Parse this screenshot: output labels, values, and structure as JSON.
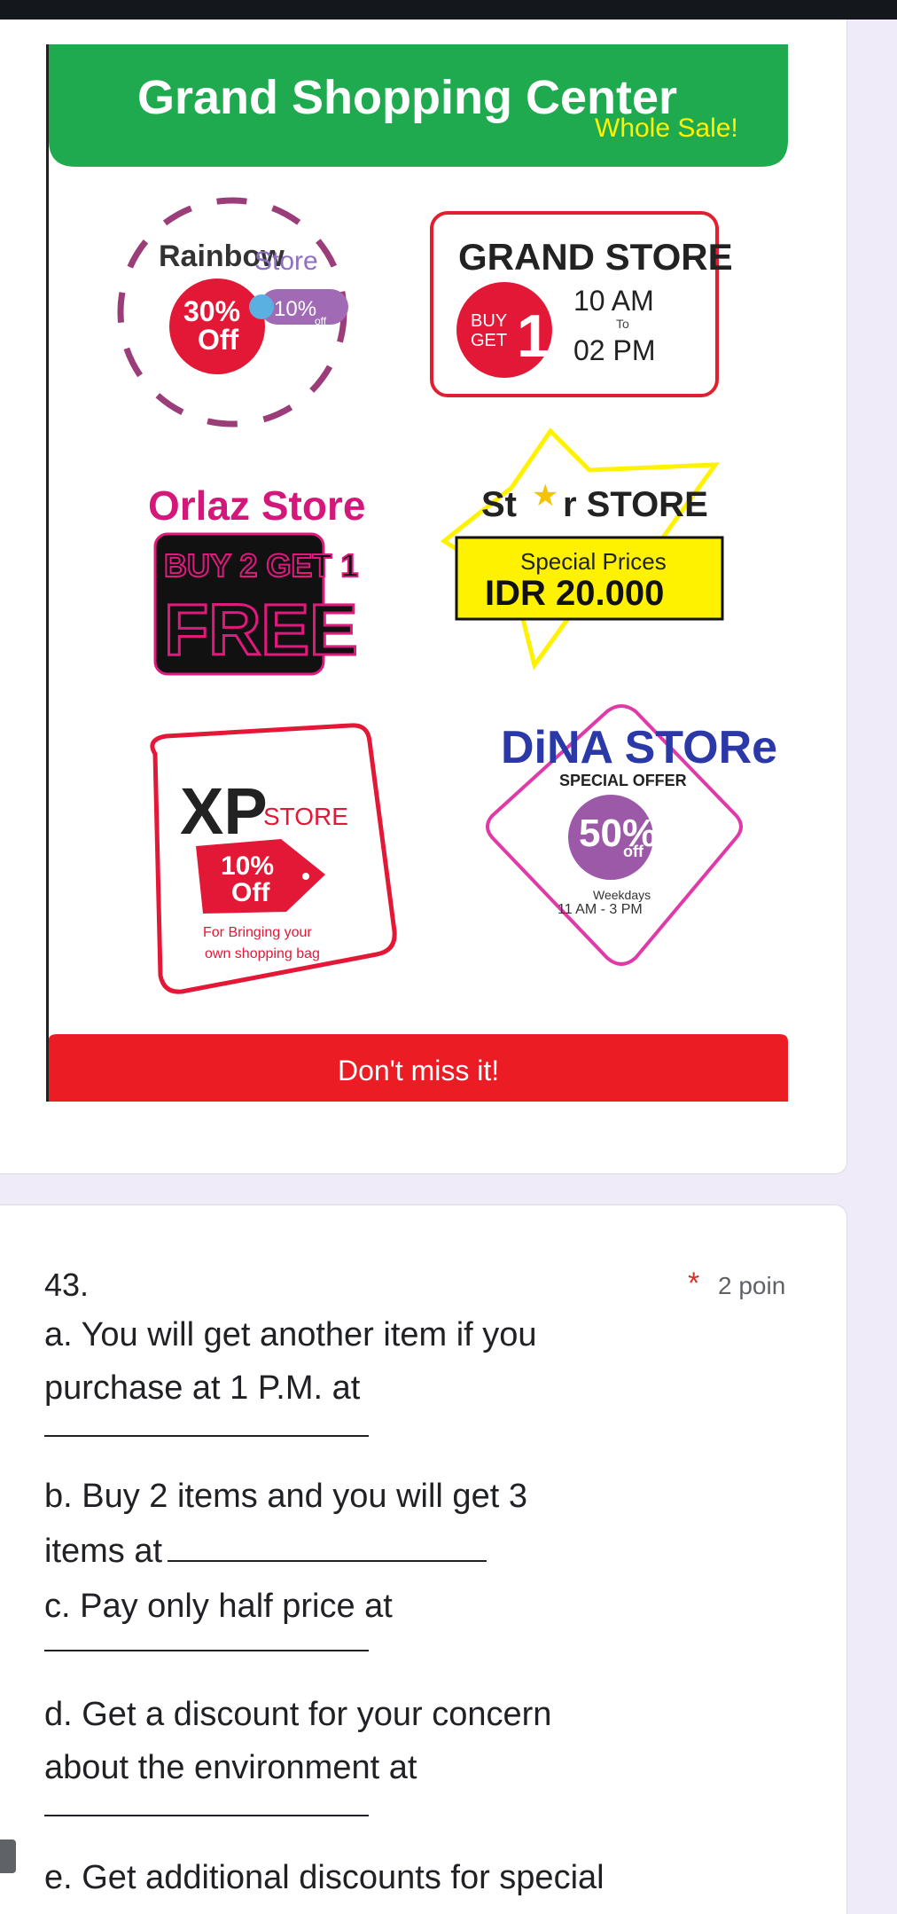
{
  "poster": {
    "title": "Grand Shopping Center",
    "subtitle": "Whole Sale!",
    "footer": "Don't miss it!",
    "rainbow": {
      "name1": "Rainbow",
      "name2": "Store",
      "deal1a": "30%",
      "deal1b": "Off",
      "deal2a": "10%",
      "deal2b": "off"
    },
    "grand": {
      "name": "GRAND STORE",
      "badge_a": "BUY",
      "badge_b": "GET",
      "badge_num": "1",
      "open": "10 AM",
      "to": "To",
      "close": "02 PM"
    },
    "orlaz": {
      "name": "Orlaz Store",
      "line1": "BUY 2 GET 1",
      "line2": "FREE"
    },
    "star": {
      "name_a": "St",
      "name_b": "r STORE",
      "line1": "Special Prices",
      "line2": "IDR 20.000"
    },
    "xp": {
      "logo": "XP",
      "store": "STORE",
      "deal_a": "10%",
      "deal_b": "Off",
      "note1": "For Bringing your",
      "note2": "own shopping bag"
    },
    "dina": {
      "name": "DiNA STORe",
      "offer": "SPECIAL OFFER",
      "pct": "50%",
      "off": "off",
      "days": "Weekdays",
      "hours": "11 AM - 3 PM"
    }
  },
  "question": {
    "number": "43.",
    "required_mark": "*",
    "points": "2 poin",
    "lines": {
      "a1": "a.    You will get another item if you",
      "a2": "purchase at 1 P.M. at",
      "b1": "b.    Buy 2 items and you will get 3",
      "b2": "items at",
      "c1": "c.    Pay only half price at",
      "d1": "d.    Get a discount for your concern",
      "d2": "about the environment at",
      "e1": "e.    Get additional discounts for special"
    }
  },
  "colors": {
    "green": "#1faa4f",
    "red": "#ec1c24",
    "pink": "#e0197d",
    "purple": "#9b59a8",
    "yellow": "#fff200"
  }
}
